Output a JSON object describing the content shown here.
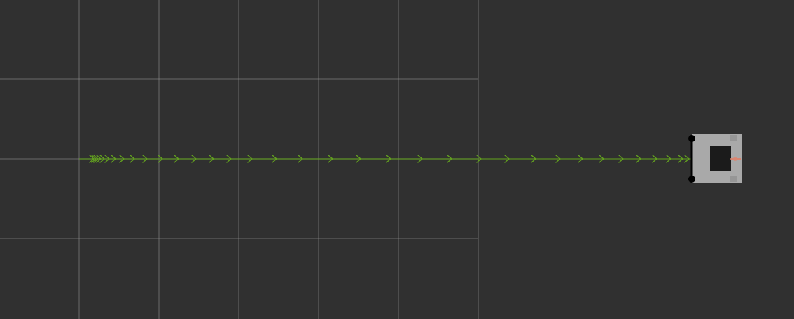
{
  "viewer": {
    "background_color": "#303030",
    "grid_color": "#9a9a9a",
    "path_color": "#62a01f",
    "robot_body_color": "#a9a9a9",
    "robot_cabin_color": "#1b1b1b",
    "robot_wheel_color": "#000000",
    "heading_marker_color": "#d98672"
  },
  "grid": {
    "show": true
  },
  "path": {
    "marker": "chevron-arrow-icon",
    "direction": "right"
  },
  "robot": {
    "icon": "robot-icon"
  }
}
